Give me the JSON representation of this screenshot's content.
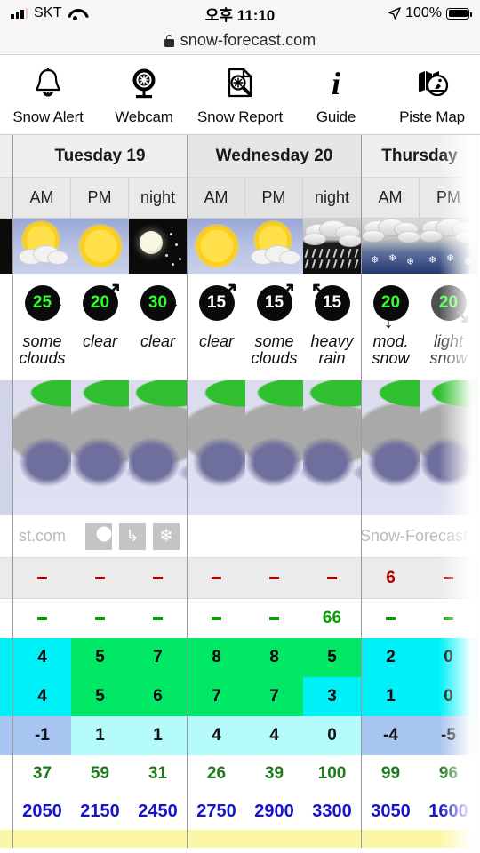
{
  "status_bar": {
    "carrier": "SKT",
    "time": "오후 11:10",
    "battery": "100%",
    "signal_icon": "signal-bars-icon",
    "wifi_icon": "wifi-icon",
    "location_icon": "location-arrow-icon",
    "battery_icon": "battery-full-icon"
  },
  "browser": {
    "url": "snow-forecast.com",
    "lock_icon": "lock-icon"
  },
  "navbar": {
    "items": [
      {
        "label": "Snow Alert",
        "icon": "bell-icon"
      },
      {
        "label": "Webcam",
        "icon": "webcam-icon"
      },
      {
        "label": "Snow Report",
        "icon": "snow-report-icon"
      },
      {
        "label": "Guide",
        "icon": "info-icon"
      },
      {
        "label": "Piste Map",
        "icon": "piste-map-icon"
      }
    ]
  },
  "map_footer": {
    "left_text": "st.com",
    "right_text": "Snow-Forecast.",
    "icons": [
      "cloud-icon",
      "arrow-down-icon",
      "snowflake-icon"
    ]
  },
  "forecast": {
    "days": [
      {
        "name": "Tuesday 19",
        "periods": [
          "AM",
          "PM",
          "night"
        ]
      },
      {
        "name": "Wednesday 20",
        "periods": [
          "AM",
          "PM",
          "night"
        ]
      },
      {
        "name": "Thursday",
        "periods": [
          "AM",
          "PM"
        ]
      }
    ],
    "columns": [
      {
        "day": "Tuesday 19",
        "period": "AM",
        "weather_icon": "sun-cloud-icon",
        "sky": "day",
        "wind_speed": "25",
        "wind_green": true,
        "wind_dir": "E",
        "description": "some clouds",
        "snow": "-",
        "rain": "-",
        "temp_max": "4",
        "temp_min": "4",
        "chill": "-1",
        "humidity": "37",
        "freezing_level": "2050",
        "temp_max_color": "cyan",
        "temp_min_color": "cyan",
        "chill_color": "blue"
      },
      {
        "day": "Tuesday 19",
        "period": "PM",
        "weather_icon": "sun-icon",
        "sky": "day",
        "wind_speed": "20",
        "wind_green": true,
        "wind_dir": "NE",
        "description": "clear",
        "snow": "-",
        "rain": "-",
        "temp_max": "5",
        "temp_min": "5",
        "chill": "1",
        "humidity": "59",
        "freezing_level": "2150",
        "temp_max_color": "green",
        "temp_min_color": "green",
        "chill_color": "lightcyan"
      },
      {
        "day": "Tuesday 19",
        "period": "night",
        "weather_icon": "moon-icon",
        "sky": "night",
        "wind_speed": "30",
        "wind_green": true,
        "wind_dir": "E",
        "description": "clear",
        "snow": "-",
        "rain": "-",
        "temp_max": "7",
        "temp_min": "6",
        "chill": "1",
        "humidity": "31",
        "freezing_level": "2450",
        "temp_max_color": "green",
        "temp_min_color": "green",
        "chill_color": "lightcyan"
      },
      {
        "day": "Wednesday 20",
        "period": "AM",
        "weather_icon": "sun-icon",
        "sky": "day",
        "wind_speed": "15",
        "wind_green": false,
        "wind_dir": "NE",
        "description": "clear",
        "snow": "-",
        "rain": "-",
        "temp_max": "8",
        "temp_min": "7",
        "chill": "4",
        "humidity": "26",
        "freezing_level": "2750",
        "temp_max_color": "green",
        "temp_min_color": "green",
        "chill_color": "lightcyan"
      },
      {
        "day": "Wednesday 20",
        "period": "PM",
        "weather_icon": "sun-cloud-icon",
        "sky": "day",
        "wind_speed": "15",
        "wind_green": false,
        "wind_dir": "NE",
        "description": "some clouds",
        "snow": "-",
        "rain": "-",
        "temp_max": "8",
        "temp_min": "7",
        "chill": "4",
        "humidity": "39",
        "freezing_level": "2900",
        "temp_max_color": "green",
        "temp_min_color": "green",
        "chill_color": "lightcyan"
      },
      {
        "day": "Wednesday 20",
        "period": "night",
        "weather_icon": "heavy-rain-icon",
        "sky": "rain",
        "wind_speed": "15",
        "wind_green": false,
        "wind_dir": "NW",
        "description": "heavy rain",
        "snow": "-",
        "rain": "66",
        "temp_max": "5",
        "temp_min": "3",
        "chill": "0",
        "humidity": "100",
        "freezing_level": "3300",
        "temp_max_color": "green",
        "temp_min_color": "cyan",
        "chill_color": "lightcyan"
      },
      {
        "day": "Thursday",
        "period": "AM",
        "weather_icon": "snow-icon",
        "sky": "snow",
        "wind_speed": "20",
        "wind_green": true,
        "wind_dir": "S",
        "description": "mod. snow",
        "snow": "6",
        "rain": "-",
        "temp_max": "2",
        "temp_min": "1",
        "chill": "-4",
        "humidity": "99",
        "freezing_level": "3050",
        "temp_max_color": "cyan",
        "temp_min_color": "cyan",
        "chill_color": "blue"
      },
      {
        "day": "Thursday",
        "period": "PM",
        "weather_icon": "snow-icon",
        "sky": "snow",
        "wind_speed": "20",
        "wind_green": true,
        "wind_dir": "SE",
        "description": "light snow",
        "snow": "-",
        "rain": "-",
        "temp_max": "0",
        "temp_min": "0",
        "chill": "-5",
        "humidity": "96",
        "freezing_level": "1600",
        "temp_max_color": "cyan",
        "temp_min_color": "cyan",
        "chill_color": "blue"
      }
    ]
  },
  "colors": {
    "cyan": "#00f0f8",
    "green": "#00e866",
    "lightcyan": "#b6fbfb",
    "blue": "#a8c4f0",
    "snow_text": "#b00000",
    "rain_text": "#089c08",
    "humidity_text": "#1f7a1f",
    "freezing_text": "#1515cf",
    "yellow_row": "#fcf6a8"
  }
}
